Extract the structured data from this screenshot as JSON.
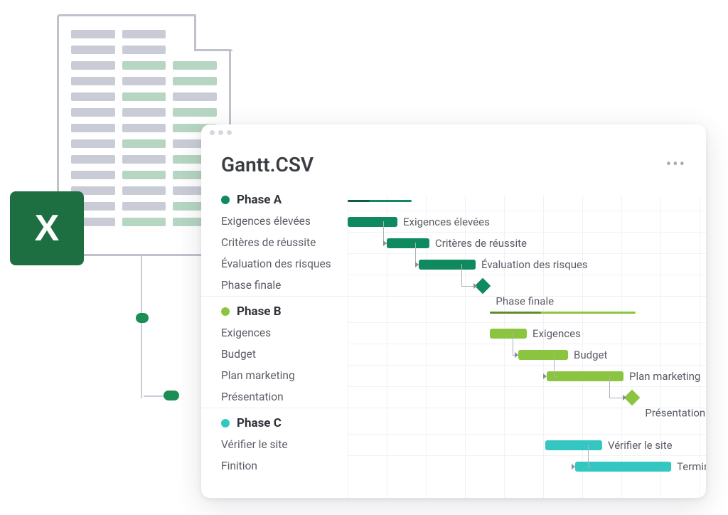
{
  "background": {
    "excel_letter": "X"
  },
  "window": {
    "title": "Gantt.CSV",
    "more_icon": "•••"
  },
  "phases": [
    {
      "name": "Phase A",
      "color": "#0f8a5f",
      "tasks": [
        {
          "label": "Exigences élevées",
          "bar_label": "Exigences élevées",
          "type": "bar",
          "start": 0,
          "len": 70,
          "color": "#0f8a5f"
        },
        {
          "label": "Critères de réussite",
          "bar_label": "Critères de réussite",
          "type": "bar",
          "start": 55,
          "len": 60,
          "color": "#0f8a5f"
        },
        {
          "label": "Évaluation des risques",
          "bar_label": "Évaluation des risques",
          "type": "bar",
          "start": 100,
          "len": 80,
          "color": "#0f8a5f"
        },
        {
          "label": "Phase finale",
          "bar_label": "Phase finale",
          "type": "milestone",
          "start": 182,
          "color": "#0f8a5f"
        }
      ],
      "summary": {
        "start": 0,
        "len": 90
      }
    },
    {
      "name": "Phase B",
      "color": "#8bc53f",
      "tasks": [
        {
          "label": "Exigences",
          "bar_label": "Exigences",
          "type": "bar",
          "start": 200,
          "len": 52,
          "color": "#8bc53f"
        },
        {
          "label": "Budget",
          "bar_label": "Budget",
          "type": "bar",
          "start": 240,
          "len": 70,
          "color": "#8bc53f"
        },
        {
          "label": "Plan marketing",
          "bar_label": "Plan marketing",
          "type": "bar",
          "start": 280,
          "len": 108,
          "color": "#8bc53f"
        },
        {
          "label": "Présentation",
          "bar_label": "Présentation",
          "type": "milestone",
          "start": 392,
          "color": "#8bc53f"
        }
      ],
      "summary": {
        "start": 200,
        "len": 205
      }
    },
    {
      "name": "Phase C",
      "color": "#34c6c0",
      "tasks": [
        {
          "label": "Vérifier le site",
          "bar_label": "Vérifier le site",
          "type": "bar",
          "start": 278,
          "len": 80,
          "color": "#34c6c0"
        },
        {
          "label": "Finition",
          "bar_label": "Terminé",
          "type": "bar",
          "start": 320,
          "len": 135,
          "color": "#34c6c0"
        }
      ]
    }
  ]
}
